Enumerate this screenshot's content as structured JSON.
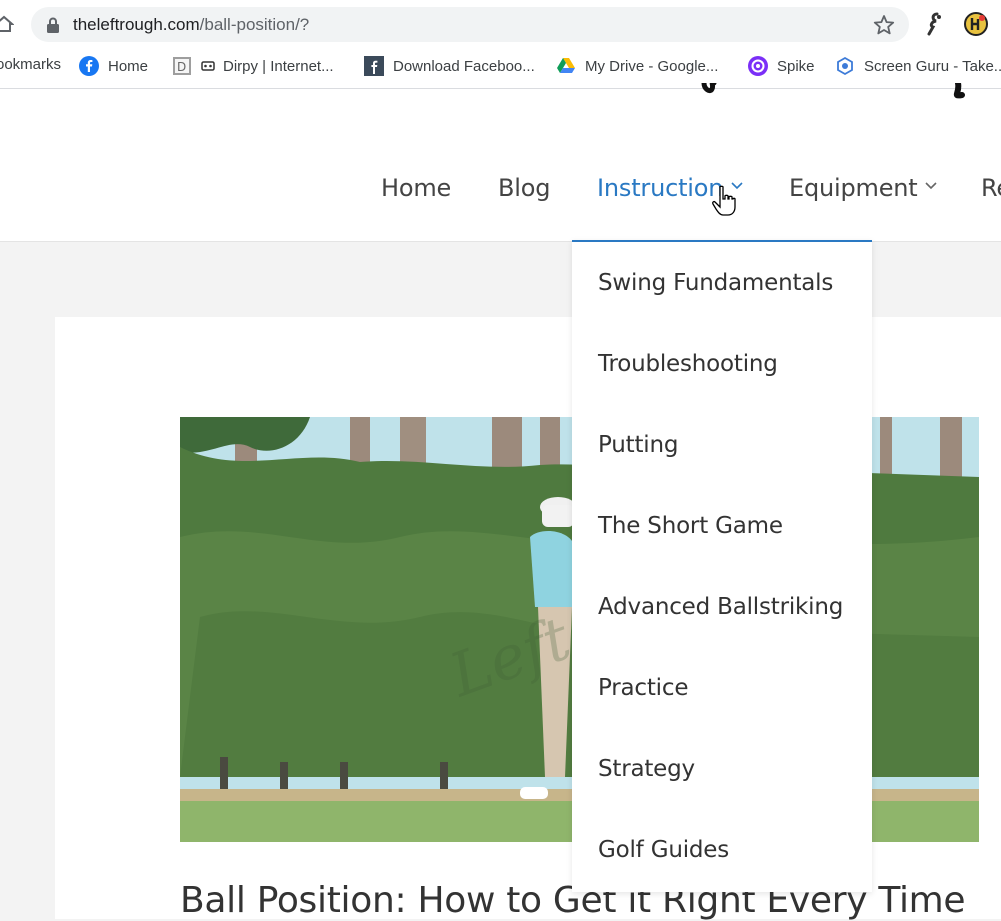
{
  "browser": {
    "url_host": "theleftrough.com",
    "url_path": "/ball-position/?",
    "bookmarks_partial": "ookmarks",
    "bookmarks": [
      {
        "label": "Home",
        "icon": "facebook-icon"
      },
      {
        "label": "Dirpy | Internet...",
        "icon": "dirpy-icon"
      },
      {
        "label": "Download Faceboo...",
        "icon": "facebook-square-icon"
      },
      {
        "label": "My Drive - Google...",
        "icon": "google-drive-icon"
      },
      {
        "label": "Spike",
        "icon": "spike-icon"
      },
      {
        "label": "Screen Guru - Take...",
        "icon": "screen-guru-icon"
      }
    ]
  },
  "nav": {
    "items": [
      {
        "label": "Home"
      },
      {
        "label": "Blog"
      },
      {
        "label": "Instruction",
        "active": true,
        "has_dropdown": true
      },
      {
        "label": "Equipment",
        "has_dropdown": true
      },
      {
        "label": "Re"
      }
    ]
  },
  "dropdown": {
    "items": [
      "Swing Fundamentals",
      "Troubleshooting",
      "Putting",
      "The Short Game",
      "Advanced Ballstriking",
      "Practice",
      "Strategy",
      "Golf Guides"
    ]
  },
  "post": {
    "title": "Ball Position: How to Get it Right Every Time"
  },
  "colors": {
    "accent": "#2a79c3",
    "page_bg": "#f3f3f3"
  }
}
